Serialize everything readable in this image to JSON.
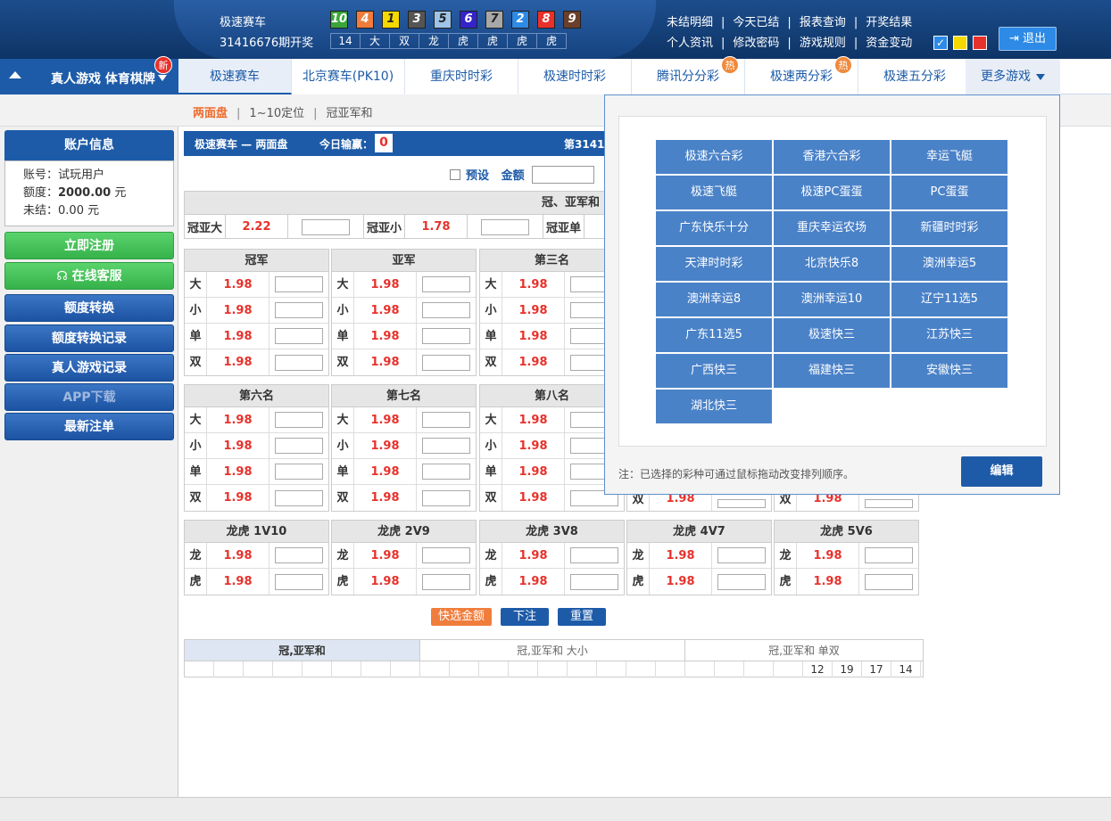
{
  "header": {
    "game_name": "极速赛车",
    "period_text": "31416676期开奖",
    "balls": [
      {
        "num": "10",
        "color": "#3aa63a"
      },
      {
        "num": "4",
        "color": "#f07d3c"
      },
      {
        "num": "1",
        "color": "#f5d800"
      },
      {
        "num": "3",
        "color": "#555555"
      },
      {
        "num": "5",
        "color": "#9ec4e8"
      },
      {
        "num": "6",
        "color": "#3324c9"
      },
      {
        "num": "7",
        "color": "#a8a8a8"
      },
      {
        "num": "2",
        "color": "#2d8ae6"
      },
      {
        "num": "8",
        "color": "#e8312b"
      },
      {
        "num": "9",
        "color": "#6b3f2a"
      }
    ],
    "results": [
      "14",
      "大",
      "双",
      "龙",
      "虎",
      "虎",
      "虎",
      "虎"
    ],
    "links_row1": [
      "未结明细",
      "今天已结",
      "报表查询",
      "开奖结果"
    ],
    "links_row2": [
      "个人资讯",
      "修改密码",
      "游戏规则",
      "资金变动"
    ],
    "theme_colors": [
      "#2d8ae6",
      "#f5d800",
      "#e8312b"
    ],
    "logout": "退出"
  },
  "nav": {
    "left_label": "真人游戏 体育棋牌",
    "left_badge": "新",
    "tabs": [
      {
        "label": "极速赛车",
        "badge": ""
      },
      {
        "label": "北京赛车(PK10)",
        "badge": ""
      },
      {
        "label": "重庆时时彩",
        "badge": ""
      },
      {
        "label": "极速时时彩",
        "badge": ""
      },
      {
        "label": "腾讯分分彩",
        "badge": "热"
      },
      {
        "label": "极速两分彩",
        "badge": "热"
      },
      {
        "label": "极速五分彩",
        "badge": ""
      }
    ],
    "more": "更多游戏"
  },
  "subnav": [
    "两面盘",
    "1~10定位",
    "冠亚军和"
  ],
  "sidebar": {
    "account_title": "账户信息",
    "account_label": "账号：",
    "account_value": "试玩用户",
    "quota_label": "额度：",
    "quota_value": "2000.00",
    "quota_unit": "元",
    "unsettled_label": "未结：",
    "unsettled_value": "0.00 元",
    "buttons": [
      "立即注册",
      "在线客服",
      "额度转换",
      "额度转换记录",
      "真人游戏记录",
      "APP下载",
      "最新注单"
    ]
  },
  "main": {
    "bar_title": "极速赛车 — 两面盘",
    "bar_today": "今日输赢：",
    "bar_count": "0",
    "bar_period": "第3141",
    "preset_label": "预设",
    "amount_label": "金额",
    "gyh": {
      "header": "冠、亚军和",
      "cells": [
        {
          "label": "冠亚大",
          "odd": "2.22"
        },
        {
          "label": "冠亚小",
          "odd": "1.78"
        },
        {
          "label": "冠亚单",
          "odd": ""
        }
      ]
    },
    "tables_row1": [
      {
        "title": "冠军",
        "rows": [
          [
            "大",
            "1.98"
          ],
          [
            "小",
            "1.98"
          ],
          [
            "单",
            "1.98"
          ],
          [
            "双",
            "1.98"
          ]
        ]
      },
      {
        "title": "亚军",
        "rows": [
          [
            "大",
            "1.98"
          ],
          [
            "小",
            "1.98"
          ],
          [
            "单",
            "1.98"
          ],
          [
            "双",
            "1.98"
          ]
        ]
      },
      {
        "title": "第三名",
        "rows": [
          [
            "大",
            "1.98"
          ],
          [
            "小",
            "1.98"
          ],
          [
            "单",
            "1.98"
          ],
          [
            "双",
            "1.98"
          ]
        ]
      }
    ],
    "tables_row2": [
      {
        "title": "第六名",
        "rows": [
          [
            "大",
            "1.98"
          ],
          [
            "小",
            "1.98"
          ],
          [
            "单",
            "1.98"
          ],
          [
            "双",
            "1.98"
          ]
        ]
      },
      {
        "title": "第七名",
        "rows": [
          [
            "大",
            "1.98"
          ],
          [
            "小",
            "1.98"
          ],
          [
            "单",
            "1.98"
          ],
          [
            "双",
            "1.98"
          ]
        ]
      },
      {
        "title": "第八名",
        "rows": [
          [
            "大",
            "1.98"
          ],
          [
            "小",
            "1.98"
          ],
          [
            "单",
            "1.98"
          ],
          [
            "双",
            "1.98"
          ]
        ]
      }
    ],
    "row2_partial_odds": [
      "1.98",
      "1.98"
    ],
    "row2_partial_key": "双",
    "tables_row3": [
      {
        "title": "龙虎 1V10",
        "rows": [
          [
            "龙",
            "1.98"
          ],
          [
            "虎",
            "1.98"
          ]
        ]
      },
      {
        "title": "龙虎 2V9",
        "rows": [
          [
            "龙",
            "1.98"
          ],
          [
            "虎",
            "1.98"
          ]
        ]
      },
      {
        "title": "龙虎 3V8",
        "rows": [
          [
            "龙",
            "1.98"
          ],
          [
            "虎",
            "1.98"
          ]
        ]
      },
      {
        "title": "龙虎 4V7",
        "rows": [
          [
            "龙",
            "1.98"
          ],
          [
            "虎",
            "1.98"
          ]
        ]
      },
      {
        "title": "龙虎 5V6",
        "rows": [
          [
            "龙",
            "1.98"
          ],
          [
            "虎",
            "1.98"
          ]
        ]
      }
    ],
    "buttons": [
      "快选金额",
      "下注",
      "重置"
    ]
  },
  "stats": {
    "tabs": [
      "冠,亚军和",
      "冠,亚军和 大小",
      "冠,亚军和 单双"
    ],
    "values": [
      "12",
      "19",
      "17",
      "14"
    ]
  },
  "popup": {
    "games": [
      "极速六合彩",
      "香港六合彩",
      "幸运飞艇",
      "极速飞艇",
      "极速PC蛋蛋",
      "PC蛋蛋",
      "广东快乐十分",
      "重庆幸运农场",
      "新疆时时彩",
      "天津时时彩",
      "北京快乐8",
      "澳洲幸运5",
      "澳洲幸运8",
      "澳洲幸运10",
      "辽宁11选5",
      "广东11选5",
      "极速快三",
      "江苏快三",
      "广西快三",
      "福建快三",
      "安徽快三",
      "湖北快三"
    ],
    "note": "注：已选择的彩种可通过鼠标拖动改变排列顺序。",
    "edit": "编辑"
  }
}
